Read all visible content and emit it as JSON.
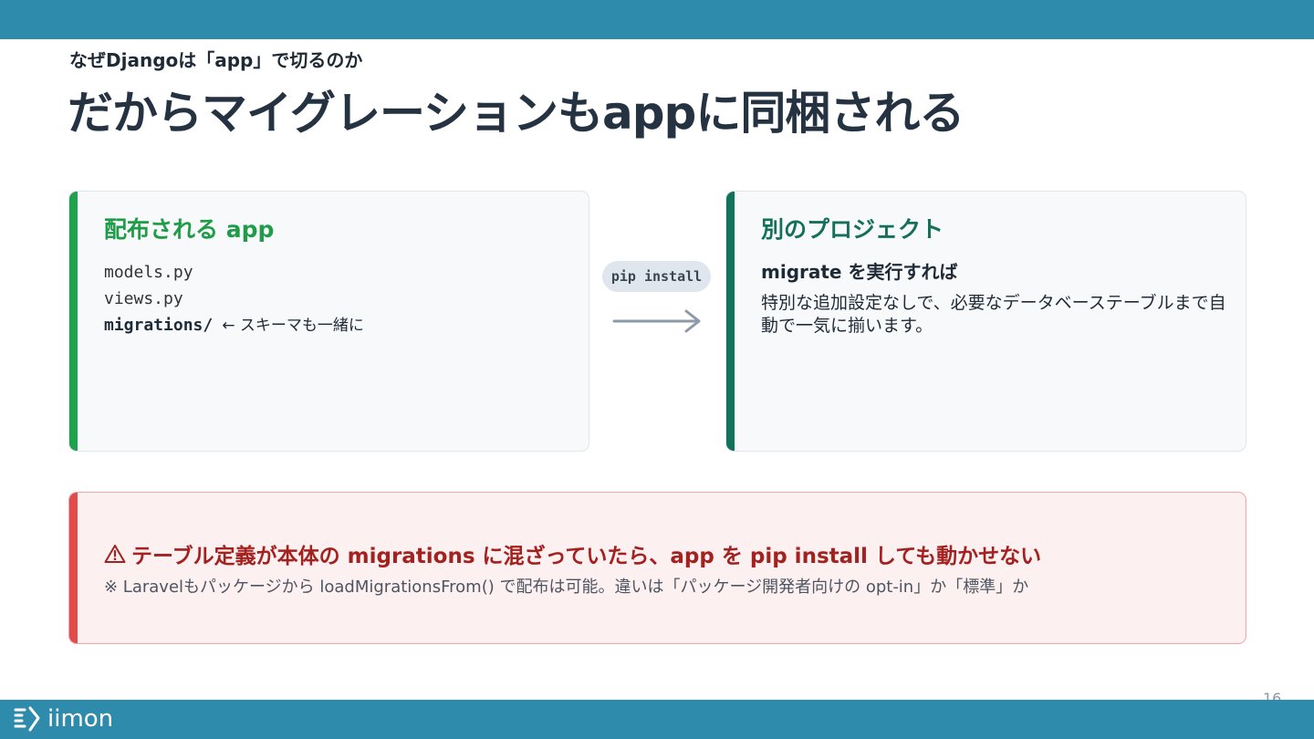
{
  "header": {
    "subtitle": "なぜDjangoは「app」で切るのか",
    "title": "だからマイグレーションもappに同梱される"
  },
  "left_card": {
    "heading": "配布される app",
    "files": [
      {
        "name": "models.py"
      },
      {
        "name": "views.py"
      },
      {
        "name": "migrations/",
        "note": "← スキーマも一緒に"
      }
    ]
  },
  "connector": {
    "label": "pip install",
    "arrow_icon": "arrow-right-icon"
  },
  "right_card": {
    "heading": "別のプロジェクト",
    "run_heading": "migrate を実行すれば",
    "body": "特別な追加設定なしで、必要なデータベーステーブルまで自動で一気に揃います。"
  },
  "warning": {
    "icon": "warning-triangle-icon",
    "heading": "テーブル定義が本体の migrations に混ざっていたら、app を pip install しても動かせない",
    "note": "※ Laravelもパッケージから loadMigrationsFrom() で配布は可能。違いは「パッケージ開発者向けの opt-in」か「標準」か"
  },
  "footer": {
    "page_number": "16",
    "logo_text": "iimon",
    "logo_icon": "iimon-logo-icon"
  },
  "colors": {
    "brand_bar": "#2e8bab",
    "green_accent": "#1fa24c",
    "teal_accent": "#13735a",
    "red_accent": "#e24b4b",
    "warning_text": "#a3211f"
  }
}
